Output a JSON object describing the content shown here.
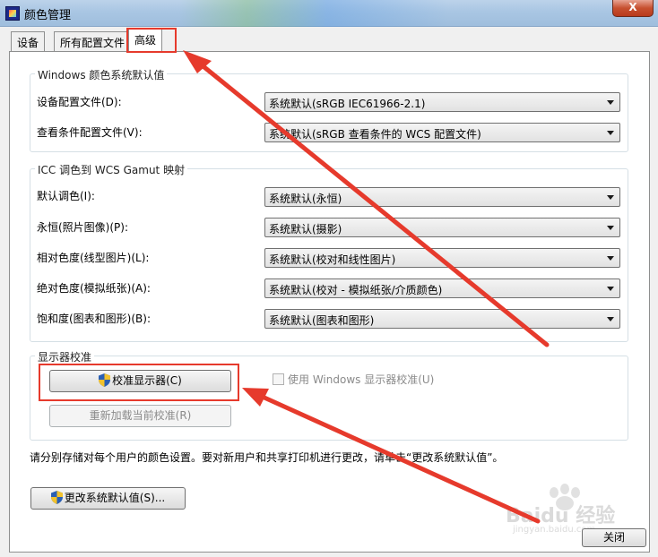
{
  "window": {
    "title": "颜色管理",
    "close_label": "X"
  },
  "tabs": [
    {
      "label": "设备"
    },
    {
      "label": "所有配置文件"
    },
    {
      "label": "高级",
      "active": true
    }
  ],
  "windows_defaults": {
    "title": "Windows 颜色系统默认值",
    "rows": [
      {
        "label": "设备配置文件(D):",
        "value": "系统默认(sRGB IEC61966-2.1)"
      },
      {
        "label": "查看条件配置文件(V):",
        "value": "系统默认(sRGB 查看条件的 WCS 配置文件)"
      }
    ]
  },
  "icc_mapping": {
    "title": "ICC 调色到 WCS Gamut 映射",
    "rows": [
      {
        "label": "默认调色(I):",
        "value": "系统默认(永恒)"
      },
      {
        "label": "永恒(照片图像)(P):",
        "value": "系统默认(摄影)"
      },
      {
        "label": "相对色度(线型图片)(L):",
        "value": "系统默认(校对和线性图片)"
      },
      {
        "label": "绝对色度(模拟纸张)(A):",
        "value": "系统默认(校对 - 模拟纸张/介质颜色)"
      },
      {
        "label": "饱和度(图表和图形)(B):",
        "value": "系统默认(图表和图形)"
      }
    ]
  },
  "display_calibration": {
    "title": "显示器校准",
    "calibrate_button": "校准显示器(C)",
    "reload_button": "重新加载当前校准(R)",
    "use_windows_checkbox": "使用 Windows 显示器校准(U)",
    "use_windows_checked": false
  },
  "info_text": "请分别存储对每个用户的颜色设置。要对新用户和共享打印机进行更改，请单击“更改系统默认值”。",
  "change_defaults_button": "更改系统默认值(S)...",
  "close_button": "关闭",
  "watermark": {
    "brand": "Baidu 经验",
    "url": "jingyan.baidu.com"
  },
  "colors": {
    "highlight": "#e63a2c",
    "arrow": "#e63a2c",
    "title_bar": "#a9c6e3"
  }
}
